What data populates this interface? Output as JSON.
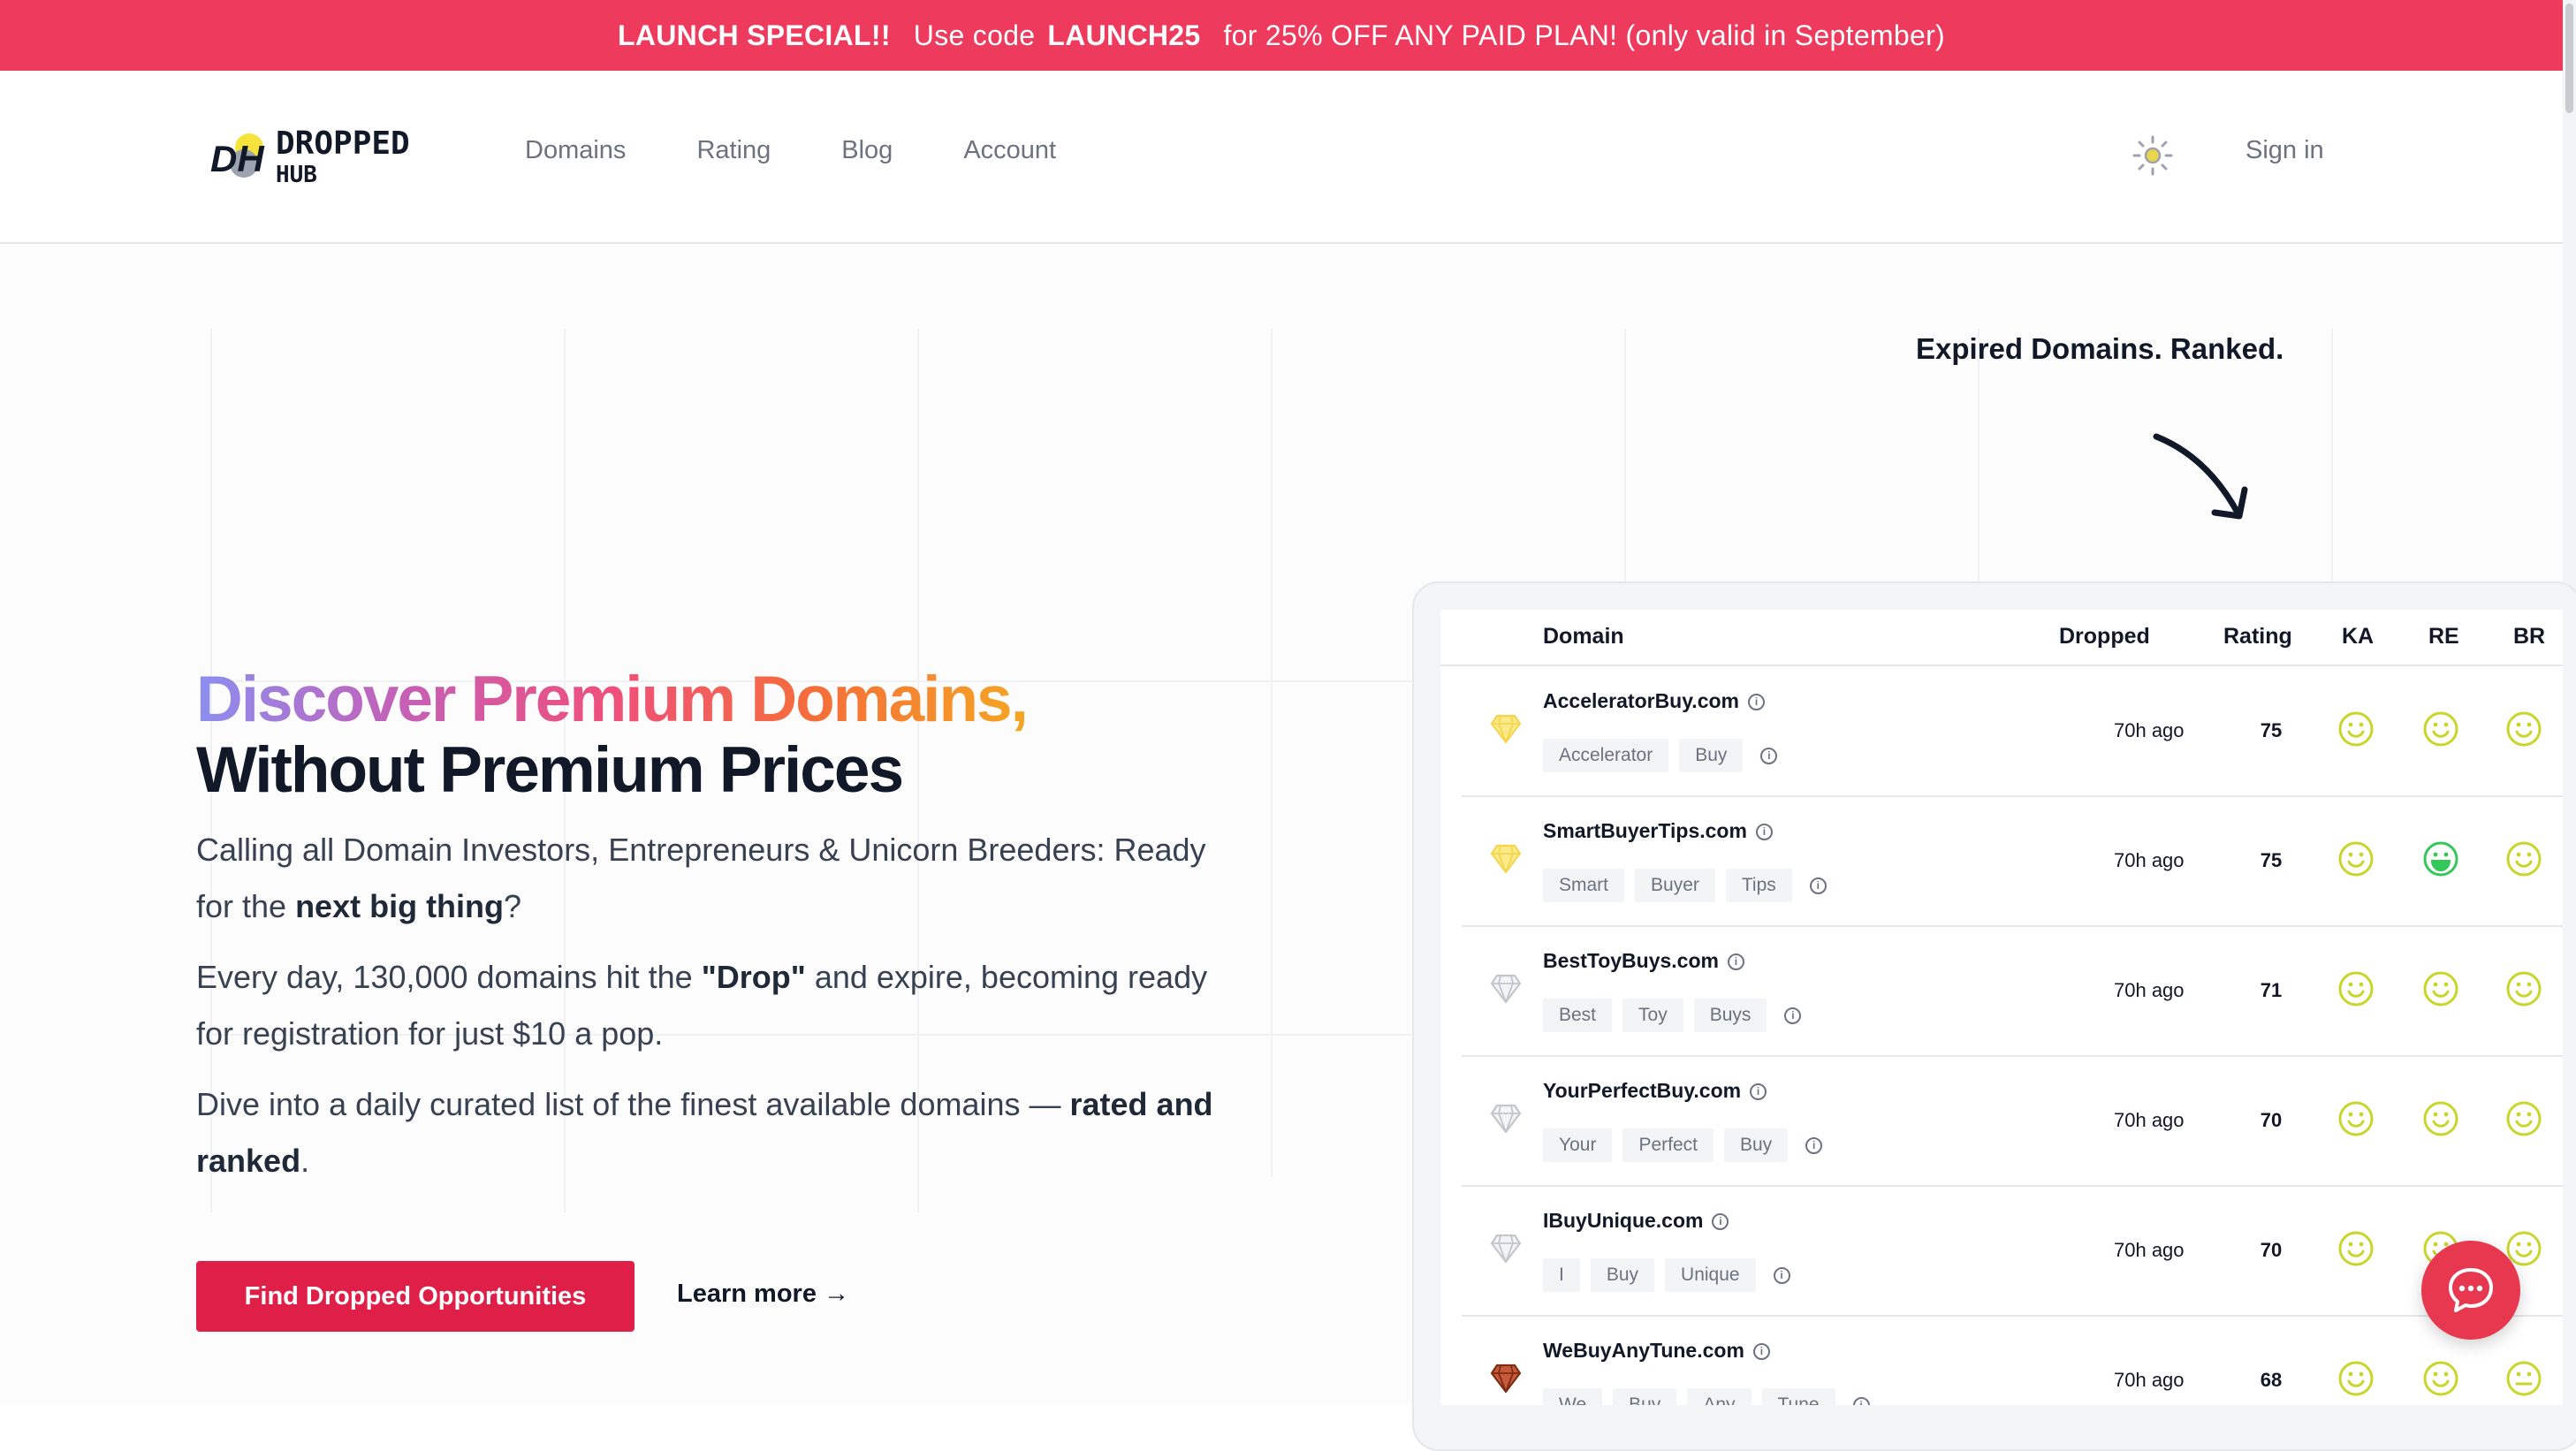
{
  "banner": {
    "special": "LAUNCH SPECIAL!!",
    "use_code": "Use code",
    "code": "LAUNCH25",
    "offer": "for 25% OFF ANY PAID PLAN! (only valid in September)"
  },
  "header": {
    "logo_initials": "DH",
    "logo_word1": "DROPPED",
    "logo_word2": "HUB",
    "nav": [
      "Domains",
      "Rating",
      "Blog",
      "Account"
    ],
    "theme_icon": "sun-icon",
    "sign_in": "Sign in"
  },
  "hero": {
    "title_line1_gradient": "Discover Premium Domains,",
    "title_line2": "Without Premium Prices",
    "p1_start": "Calling all Domain Investors, Entrepreneurs & Unicorn Breeders: Ready for the ",
    "p1_bold": "next big thing",
    "p1_end": "?",
    "p2_start": "Every day, 130,000 domains hit the ",
    "p2_bold": "\"Drop\"",
    "p2_end": " and expire, becoming ready for registration for just $10 a pop.",
    "p3_start": "Dive into a daily curated list of the finest available domains — ",
    "p3_bold": "rated and ranked",
    "p3_end": ".",
    "cta": "Find Dropped Opportunities",
    "learn_more": "Learn more →"
  },
  "tagline": "Expired Domains. Ranked.",
  "table": {
    "headers": {
      "domain": "Domain",
      "dropped": "Dropped",
      "rating": "Rating",
      "ka": "KA",
      "re": "RE",
      "br": "BR"
    },
    "rows": [
      {
        "gem": "gold",
        "domain": "AcceleratorBuy.com",
        "tags": [
          "Accelerator",
          "Buy"
        ],
        "dropped": "70h ago",
        "rating": "75",
        "ka": "smile",
        "re": "smile",
        "br": "smile"
      },
      {
        "gem": "gold",
        "domain": "SmartBuyerTips.com",
        "tags": [
          "Smart",
          "Buyer",
          "Tips"
        ],
        "dropped": "70h ago",
        "rating": "75",
        "ka": "smile",
        "re": "grin",
        "br": "smile"
      },
      {
        "gem": "gray",
        "domain": "BestToyBuys.com",
        "tags": [
          "Best",
          "Toy",
          "Buys"
        ],
        "dropped": "70h ago",
        "rating": "71",
        "ka": "smile",
        "re": "smile",
        "br": "smile"
      },
      {
        "gem": "gray",
        "domain": "YourPerfectBuy.com",
        "tags": [
          "Your",
          "Perfect",
          "Buy"
        ],
        "dropped": "70h ago",
        "rating": "70",
        "ka": "smile",
        "re": "smile",
        "br": "smile"
      },
      {
        "gem": "gray",
        "domain": "IBuyUnique.com",
        "tags": [
          "I",
          "Buy",
          "Unique"
        ],
        "dropped": "70h ago",
        "rating": "70",
        "ka": "smile",
        "re": "smile",
        "br": "smile"
      },
      {
        "gem": "brown",
        "domain": "WeBuyAnyTune.com",
        "tags": [
          "We",
          "Buy",
          "Any",
          "Tune"
        ],
        "dropped": "70h ago",
        "rating": "68",
        "ka": "smile",
        "re": "smile",
        "br": "neutral"
      }
    ]
  },
  "colors": {
    "banner": "#ee3a5c",
    "cta": "#df1f47",
    "chat": "#e8384f",
    "smile": "#c8d62b",
    "grin": "#34c759"
  },
  "chat_icon": "chat-bubble-icon"
}
